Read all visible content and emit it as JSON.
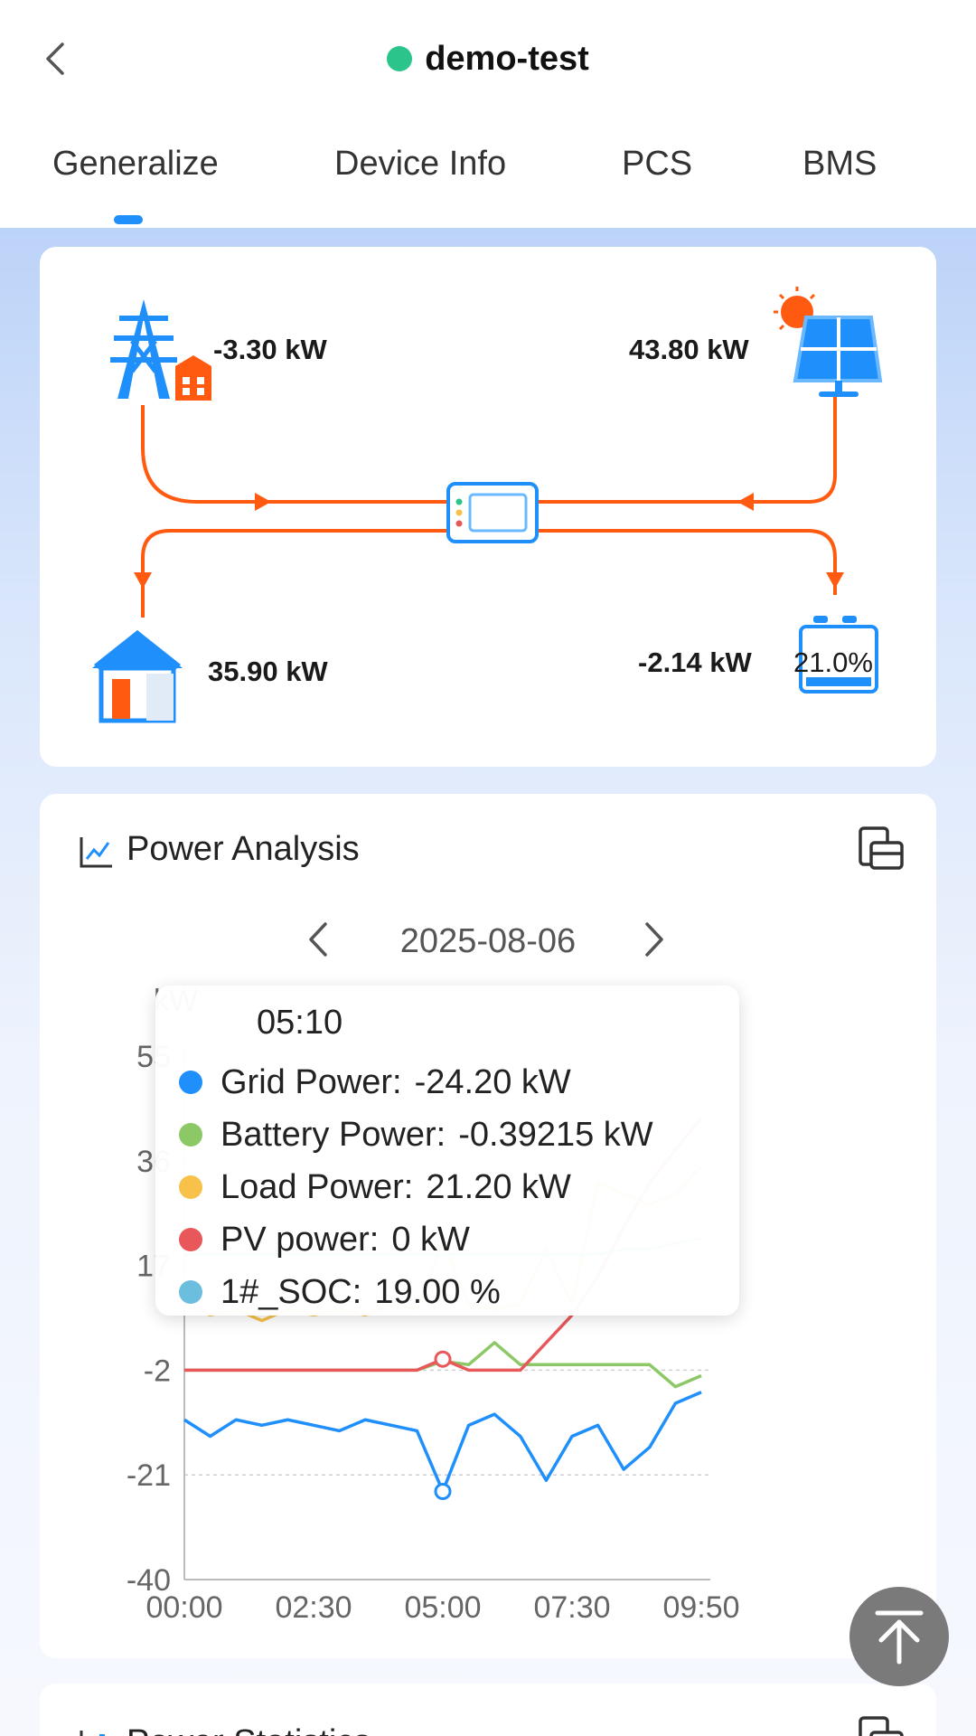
{
  "header": {
    "title": "demo-test",
    "status_color": "#2bc48a"
  },
  "tabs": [
    {
      "label": "Generalize",
      "active": true
    },
    {
      "label": "Device Info",
      "active": false
    },
    {
      "label": "PCS",
      "active": false
    },
    {
      "label": "BMS",
      "active": false
    }
  ],
  "colors": {
    "accent": "#1e8ffb",
    "flow_line": "#ff5a10",
    "icon_blue": "#1e8ffb",
    "icon_orange": "#ff5a10"
  },
  "flow": {
    "grid": {
      "value": "-3.30 kW",
      "icon": "power-tower-icon"
    },
    "pv": {
      "value": "43.80 kW",
      "icon": "solar-panel-icon"
    },
    "load": {
      "value": "35.90 kW",
      "icon": "house-icon"
    },
    "battery": {
      "value": "-2.14 kW",
      "soc": "21.0%",
      "icon": "battery-icon"
    },
    "inverter": {
      "icon": "inverter-icon"
    }
  },
  "power_analysis": {
    "title": "Power Analysis",
    "date": "2025-08-06",
    "unit": "kW",
    "tooltip": {
      "time": "05:10",
      "rows": [
        {
          "label": "Grid Power:",
          "value": "-24.20 kW",
          "color": "#1e8ffb"
        },
        {
          "label": "Battery Power:",
          "value": "-0.39215 kW",
          "color": "#8cc866"
        },
        {
          "label": "Load Power:",
          "value": "21.20 kW",
          "color": "#f7c14a"
        },
        {
          "label": "PV power:",
          "value": "0 kW",
          "color": "#e8585b"
        },
        {
          "label": "1#_SOC:",
          "value": "19.00 %",
          "color": "#6cbedf"
        }
      ]
    }
  },
  "chart_data": {
    "type": "line",
    "ylabel": "kW",
    "ylim": [
      -40,
      55
    ],
    "y_ticks": [
      "55",
      "36",
      "17",
      "-2",
      "-21",
      "-40"
    ],
    "x_ticks": [
      "00:00",
      "02:30",
      "05:00",
      "07:30",
      "09:50"
    ],
    "grid": true,
    "x": [
      "00:00",
      "00:30",
      "01:00",
      "01:30",
      "02:00",
      "02:30",
      "03:00",
      "03:30",
      "04:00",
      "04:30",
      "05:00",
      "05:30",
      "06:00",
      "06:30",
      "07:00",
      "07:30",
      "08:00",
      "08:30",
      "09:00",
      "09:30",
      "09:50"
    ],
    "series": [
      {
        "name": "Grid Power",
        "color": "#1e8ffb",
        "values": [
          -11,
          -14,
          -11,
          -12,
          -11,
          -12,
          -13,
          -11,
          -12,
          -13,
          -24,
          -12,
          -10,
          -14,
          -22,
          -14,
          -12,
          -20,
          -16,
          -8,
          -6
        ]
      },
      {
        "name": "Battery Power",
        "color": "#8cc866",
        "values": [
          -2,
          -2,
          -2,
          -2,
          -2,
          -2,
          -2,
          -2,
          -2,
          -2,
          -0.39,
          -1,
          3,
          -1,
          -1,
          -1,
          -1,
          -1,
          -1,
          -5,
          -3
        ]
      },
      {
        "name": "Load Power",
        "color": "#f7c14a",
        "values": [
          10,
          8,
          9,
          7,
          9,
          8,
          9,
          8,
          10,
          9,
          21.2,
          10,
          9,
          10,
          20,
          10,
          32,
          30,
          28,
          30,
          35
        ]
      },
      {
        "name": "PV power",
        "color": "#e8585b",
        "values": [
          -2,
          -2,
          -2,
          -2,
          -2,
          -2,
          -2,
          -2,
          -2,
          -2,
          0,
          -2,
          -2,
          -2,
          3,
          8,
          15,
          24,
          32,
          38,
          43.8
        ]
      },
      {
        "name": "1#_SOC",
        "color": "#6cbedf",
        "values": [
          19,
          19,
          19,
          19,
          19,
          19,
          19,
          19,
          19,
          19,
          19,
          19,
          19,
          19,
          19,
          19,
          19,
          20,
          20,
          21,
          22
        ]
      }
    ],
    "highlight_index": 10
  },
  "power_statistics": {
    "title": "Power Statistics"
  }
}
